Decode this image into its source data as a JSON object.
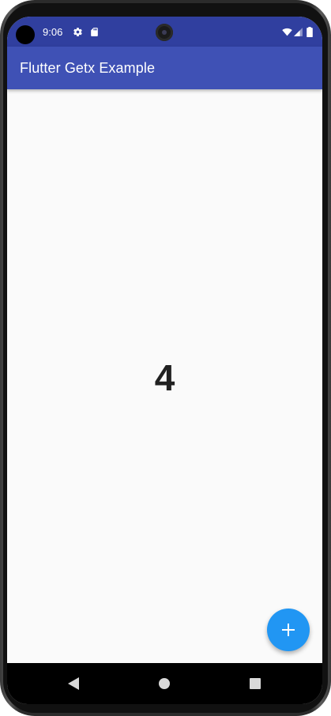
{
  "status_bar": {
    "time": "9:06",
    "color": "#303f9f",
    "left_icons": [
      "gear-icon",
      "sd-card-icon"
    ],
    "right_icons": [
      "wifi-icon",
      "signal-icon",
      "battery-icon"
    ]
  },
  "app_bar": {
    "title": "Flutter Getx Example",
    "color": "#3f51b5"
  },
  "counter": {
    "value": "4"
  },
  "fab": {
    "icon": "add-icon",
    "color": "#2196f3"
  },
  "nav_bar": {
    "buttons": [
      "back-icon",
      "home-icon",
      "recents-icon"
    ]
  }
}
